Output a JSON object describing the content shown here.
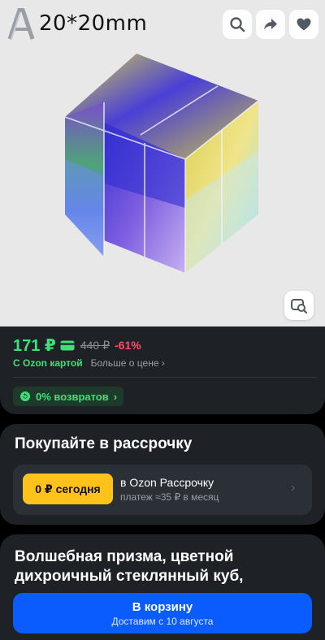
{
  "hero": {
    "caption": "20*20mm",
    "logo_letter": "A",
    "icons": [
      "search-icon",
      "share-icon",
      "heart-icon",
      "image-search-icon"
    ]
  },
  "price": {
    "current": "171 ₽",
    "old": "440 ₽",
    "discount": "-61%",
    "card_label": "С Ozon картой",
    "more_label": "Больше о цене",
    "more_chevron": "›",
    "returns_label": "0% возвратов",
    "returns_chevron": "›"
  },
  "installment": {
    "title": "Покупайте в рассрочку",
    "badge": "0 ₽ сегодня",
    "name": "в Ozon Рассрочку",
    "subtitle": "платеж ≈35 ₽ в месяц",
    "chevron": "›"
  },
  "product": {
    "title": "Волшебная призма, цветной дихроичный стеклянный куб,"
  },
  "cart": {
    "label": "В корзину",
    "sub": "Доставим с 10 августа"
  },
  "colors": {
    "accent_green": "#3ee07a",
    "discount_red": "#ff4d6a",
    "cart_blue": "#0a5cff",
    "badge_yellow": "#ffc21a",
    "panel": "#1e2126"
  }
}
